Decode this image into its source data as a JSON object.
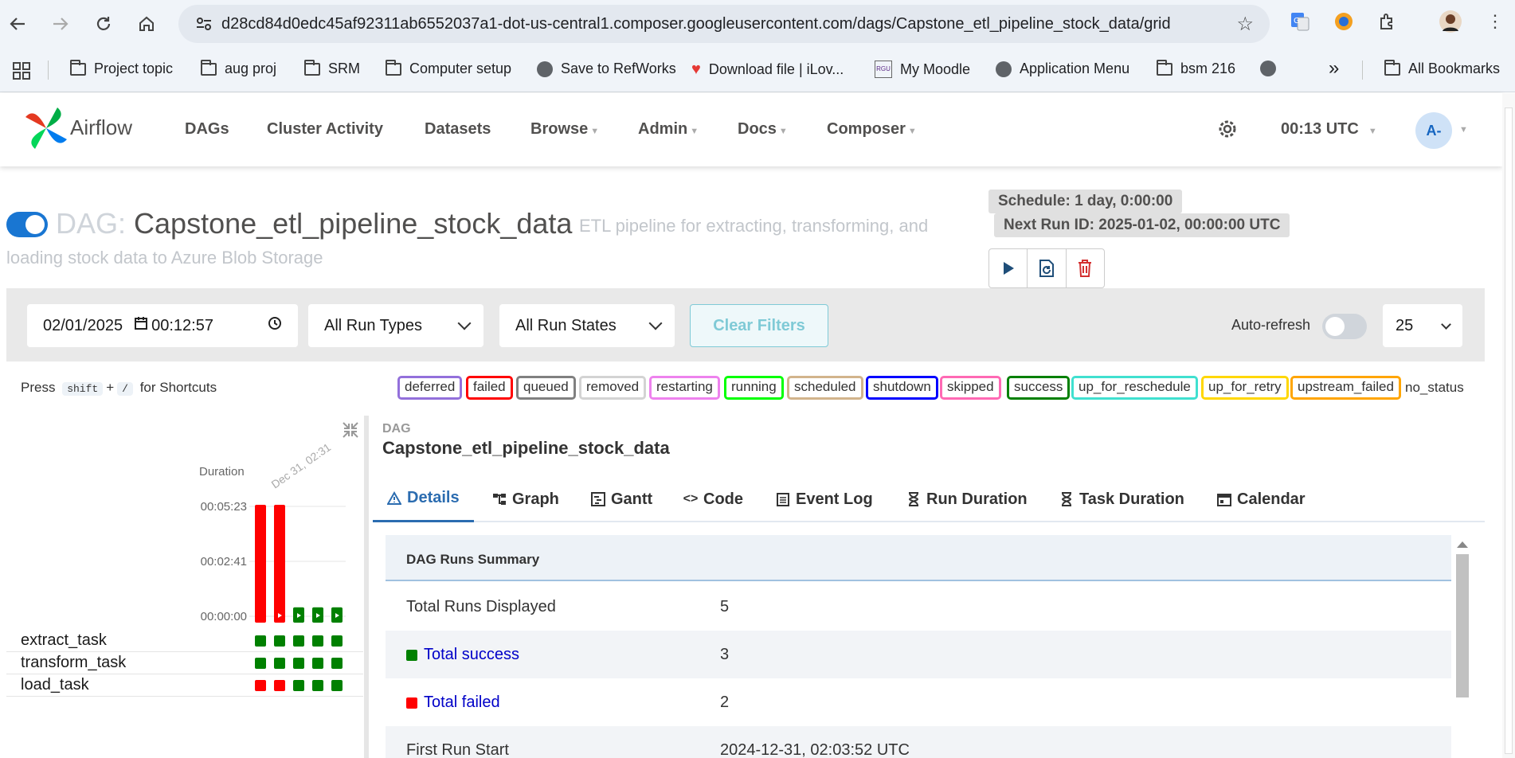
{
  "browser": {
    "url": "d28cd84d0edc45af92311ab6552037a1-dot-us-central1.composer.googleusercontent.com/dags/Capstone_etl_pipeline_stock_data/grid",
    "bookmarks": [
      {
        "label": "Project topic",
        "icon": "folder-icon"
      },
      {
        "label": "aug proj",
        "icon": "folder-icon"
      },
      {
        "label": "SRM",
        "icon": "folder-icon"
      },
      {
        "label": "Computer setup",
        "icon": "folder-icon"
      },
      {
        "label": "Save to RefWorks",
        "icon": "globe-icon"
      },
      {
        "label": "Download file | iLov...",
        "icon": "heart-icon"
      },
      {
        "label": "My Moodle",
        "icon": "rgu-icon"
      },
      {
        "label": "Application Menu",
        "icon": "globe-icon"
      },
      {
        "label": "bsm 216",
        "icon": "folder-icon"
      }
    ],
    "all_bookmarks": "All Bookmarks",
    "overflow": "»"
  },
  "navbar": {
    "logo_text": "Airflow",
    "menu": [
      {
        "label": "DAGs",
        "dropdown": false
      },
      {
        "label": "Cluster Activity",
        "dropdown": false
      },
      {
        "label": "Datasets",
        "dropdown": false
      },
      {
        "label": "Browse",
        "dropdown": true
      },
      {
        "label": "Admin",
        "dropdown": true
      },
      {
        "label": "Docs",
        "dropdown": true
      },
      {
        "label": "Composer",
        "dropdown": true
      }
    ],
    "time": "00:13 UTC",
    "avatar": "A-"
  },
  "dag": {
    "prefix": "DAG:",
    "name": "Capstone_etl_pipeline_stock_data",
    "description_1": "ETL pipeline for extracting, transforming, and",
    "description_2": "loading stock data to Azure Blob Storage",
    "schedule": "Schedule: 1 day, 0:00:00",
    "next_run": "Next Run ID: 2025-01-02, 00:00:00 UTC",
    "paused": false
  },
  "filters": {
    "date": "02/01/2025",
    "time": "00:12:57",
    "run_types": "All Run Types",
    "run_states": "All Run States",
    "clear": "Clear Filters",
    "auto_refresh_label": "Auto-refresh",
    "auto_refresh_on": false,
    "page_size": "25"
  },
  "shortcuts": {
    "press": "Press",
    "key1": "shift",
    "plus": "+",
    "key2": "/",
    "suffix": "for Shortcuts"
  },
  "legend": [
    {
      "label": "deferred",
      "color": "#9370db"
    },
    {
      "label": "failed",
      "color": "#ff0000"
    },
    {
      "label": "queued",
      "color": "#808080"
    },
    {
      "label": "removed",
      "color": "#d3d3d3"
    },
    {
      "label": "restarting",
      "color": "#ee82ee"
    },
    {
      "label": "running",
      "color": "#00ff00"
    },
    {
      "label": "scheduled",
      "color": "#d2b48c"
    },
    {
      "label": "shutdown",
      "color": "#0000ff"
    },
    {
      "label": "skipped",
      "color": "#ff69b4"
    },
    {
      "label": "success",
      "color": "#008000"
    },
    {
      "label": "up_for_reschedule",
      "color": "#40e0d0"
    },
    {
      "label": "up_for_retry",
      "color": "#ffd700"
    },
    {
      "label": "upstream_failed",
      "color": "#ffa500"
    },
    {
      "label": "no_status",
      "color": ""
    }
  ],
  "grid": {
    "duration_label": "Duration",
    "run_label": "Dec 31, 02:31",
    "ticks": [
      "00:05:23",
      "00:02:41",
      "00:00:00"
    ],
    "runs": [
      {
        "state": "failed",
        "duration_fraction": 1.0
      },
      {
        "state": "failed",
        "duration_fraction": 1.0
      },
      {
        "state": "success",
        "duration_fraction": 0.13
      },
      {
        "state": "success",
        "duration_fraction": 0.13
      },
      {
        "state": "success",
        "duration_fraction": 0.13
      }
    ],
    "tasks": [
      {
        "name": "extract_task",
        "states": [
          "success",
          "success",
          "success",
          "success",
          "success"
        ]
      },
      {
        "name": "transform_task",
        "states": [
          "success",
          "success",
          "success",
          "success",
          "success"
        ]
      },
      {
        "name": "load_task",
        "states": [
          "failed",
          "failed",
          "success",
          "success",
          "success"
        ]
      }
    ],
    "colors": {
      "success": "#008000",
      "failed": "#ff0000"
    }
  },
  "details": {
    "crumb_small": "DAG",
    "crumb_big": "Capstone_etl_pipeline_stock_data",
    "tabs": [
      {
        "label": "Details",
        "icon": "warning-icon"
      },
      {
        "label": "Graph",
        "icon": "graph-icon"
      },
      {
        "label": "Gantt",
        "icon": "gantt-icon"
      },
      {
        "label": "Code",
        "icon": "code-icon"
      },
      {
        "label": "Event Log",
        "icon": "event-log-icon"
      },
      {
        "label": "Run Duration",
        "icon": "hourglass-icon"
      },
      {
        "label": "Task Duration",
        "icon": "hourglass-icon"
      },
      {
        "label": "Calendar",
        "icon": "calendar-icon"
      }
    ],
    "summary_title": "DAG Runs Summary",
    "rows": [
      {
        "key": "Total Runs Displayed",
        "value": "5"
      },
      {
        "key": "Total success",
        "value": "3",
        "color": "#008000"
      },
      {
        "key": "Total failed",
        "value": "2",
        "color": "#ff0000"
      },
      {
        "key": "First Run Start",
        "value": "2024-12-31, 02:03:52 UTC"
      }
    ]
  }
}
